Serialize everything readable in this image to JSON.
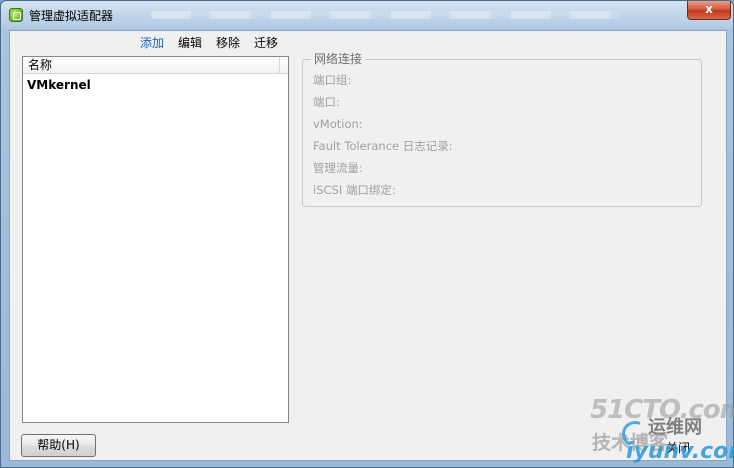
{
  "window": {
    "title": "管理虚拟适配器",
    "close_glyph": "x"
  },
  "toolbar": {
    "add": "添加",
    "edit": "编辑",
    "remove": "移除",
    "migrate": "迁移"
  },
  "list": {
    "header": "名称",
    "items": [
      "VMkernel"
    ]
  },
  "network_group": {
    "legend": "网络连接",
    "fields": [
      "端口组:",
      "端口:",
      "vMotion:",
      "Fault Tolerance 日志记录:",
      "管理流量:",
      "iSCSI 端口绑定:"
    ]
  },
  "buttons": {
    "help": "帮助(H)",
    "close": "关闭"
  },
  "watermark": {
    "line1": "51CTO.com",
    "line2": "运维网",
    "line3": "技术博客",
    "line4": "iyunv.com"
  },
  "colors": {
    "accent": "#1a63b8",
    "disabled_text": "#a0a0a0"
  }
}
